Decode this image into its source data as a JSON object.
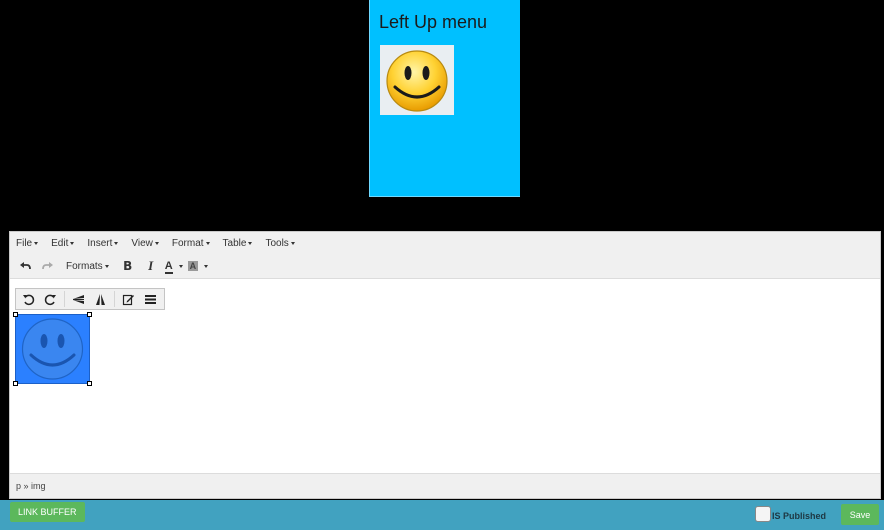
{
  "preview": {
    "title": "Left Up menu"
  },
  "menubar": {
    "items": [
      "File",
      "Edit",
      "Insert",
      "View",
      "Format",
      "Table",
      "Tools"
    ]
  },
  "toolbar": {
    "formats_label": "Formats",
    "bold_label": "B",
    "italic_label": "I",
    "text_color_label": "A",
    "bg_color_label": "A"
  },
  "statusbar": {
    "path": "p » img"
  },
  "footer": {
    "link_buffer_label": "LINK BUFFER",
    "is_published_label": "IS Published",
    "save_label": "Save"
  },
  "colors": {
    "preview_bg": "#00c0ff",
    "footer_bg": "#41a2c0",
    "button_green": "#5cb85c",
    "selection_blue": "#2b80ff"
  }
}
